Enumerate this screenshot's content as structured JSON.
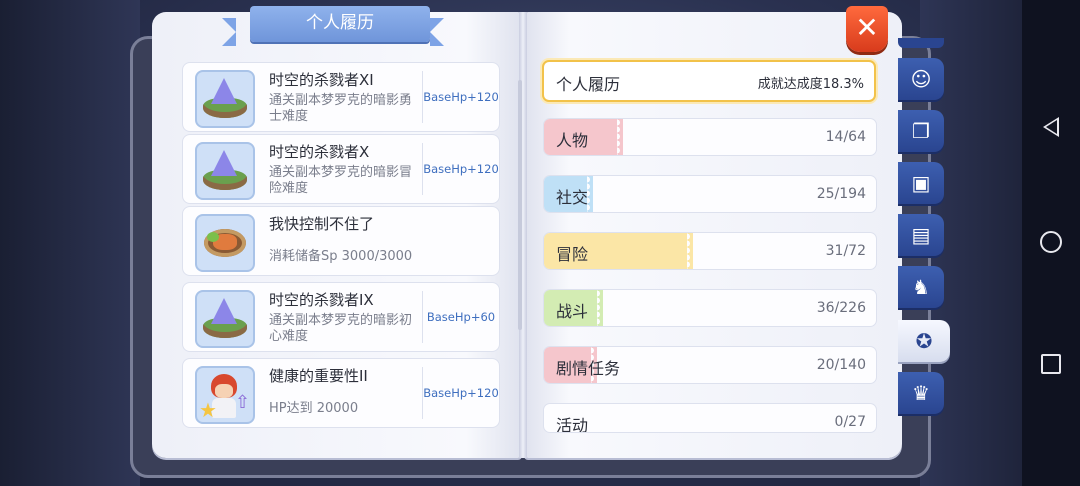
{
  "title": "个人履历",
  "close_label": "✕",
  "achievements": [
    {
      "title": "时空的杀戮者XI",
      "desc": "通关副本梦罗克的暗影勇士难度",
      "reward": "BaseHp+120",
      "icon": "crystal-island-icon"
    },
    {
      "title": "时空的杀戮者X",
      "desc": "通关副本梦罗克的暗影冒险难度",
      "reward": "BaseHp+120",
      "icon": "crystal-island-icon"
    },
    {
      "title": "我快控制不住了",
      "desc": "消耗储备Sp 3000/3000",
      "reward": "",
      "icon": "food-plate-icon"
    },
    {
      "title": "时空的杀戮者IX",
      "desc": "通关副本梦罗克的暗影初心难度",
      "reward": "BaseHp+60",
      "icon": "crystal-island-icon"
    },
    {
      "title": "健康的重要性II",
      "desc": "HP达到 20000",
      "reward": "BaseHp+120",
      "icon": "hero-levelup-icon"
    }
  ],
  "summary": {
    "title": "个人履历",
    "rate": "成就达成度18.3%"
  },
  "categories": [
    {
      "label": "人物",
      "count": "14/64",
      "progress": 0.219,
      "color": "#f5c6cc"
    },
    {
      "label": "社交",
      "count": "25/194",
      "progress": 0.129,
      "color": "#bfe0f6"
    },
    {
      "label": "冒险",
      "count": "31/72",
      "progress": 0.431,
      "color": "#fbe6a6"
    },
    {
      "label": "战斗",
      "count": "36/226",
      "progress": 0.159,
      "color": "#d3ecb3"
    },
    {
      "label": "剧情任务",
      "count": "20/140",
      "progress": 0.143,
      "color": "#f5c6cc"
    },
    {
      "label": "活动",
      "count": "0/27",
      "progress": 0.0,
      "color": "#f5c6cc"
    }
  ],
  "tabs": [
    {
      "icon": "profile-icon",
      "active": false
    },
    {
      "icon": "book-icon",
      "active": false
    },
    {
      "icon": "card-icon",
      "active": false
    },
    {
      "icon": "briefcase-icon",
      "active": false
    },
    {
      "icon": "rocking-horse-icon",
      "active": false
    },
    {
      "icon": "medal-icon",
      "active": true
    },
    {
      "icon": "cat-mask-icon",
      "active": false
    }
  ]
}
